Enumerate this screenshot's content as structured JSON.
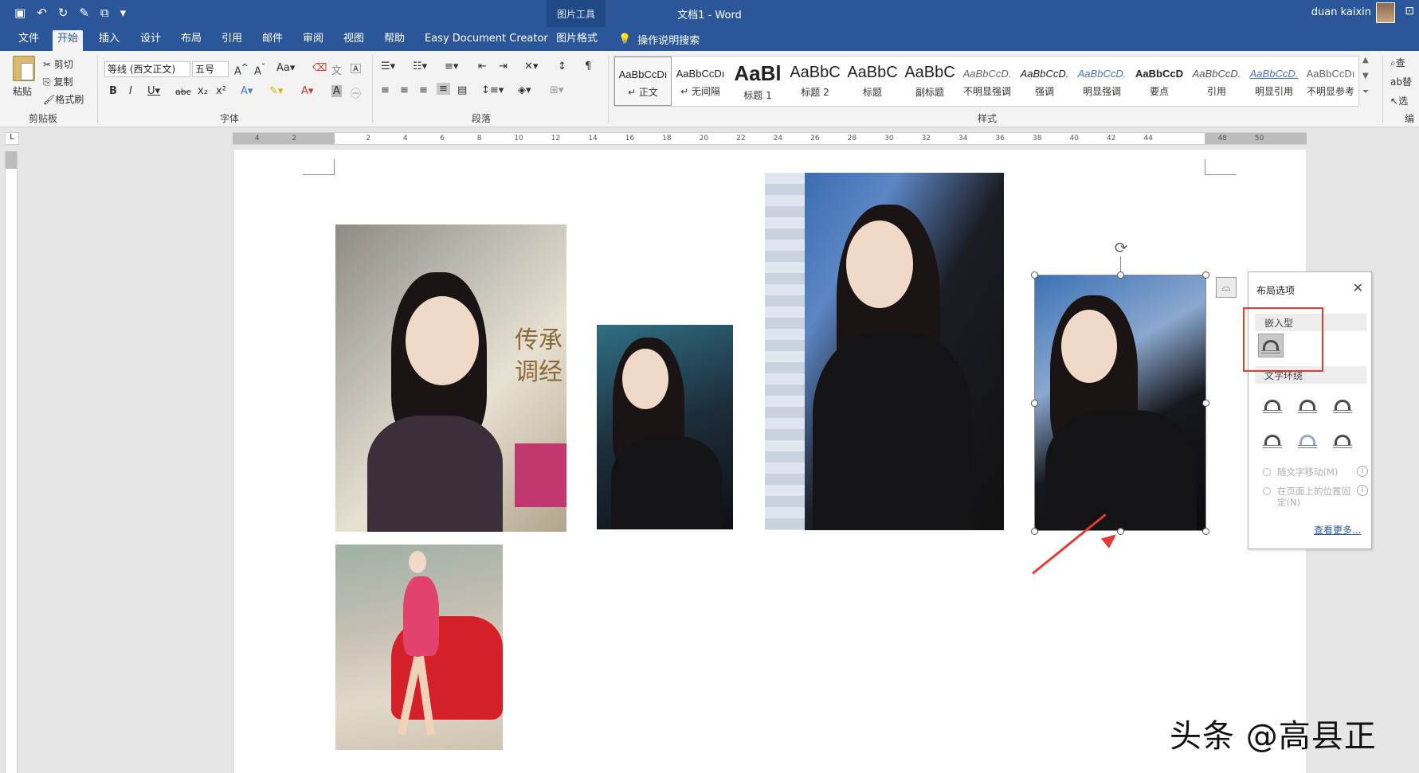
{
  "titlebar": {
    "picture_tools_label": "图片工具",
    "document_title": "文档1  -  Word",
    "user_name": "duan kaixin"
  },
  "tabs": [
    {
      "label": "文件"
    },
    {
      "label": "开始"
    },
    {
      "label": "插入"
    },
    {
      "label": "设计"
    },
    {
      "label": "布局"
    },
    {
      "label": "引用"
    },
    {
      "label": "邮件"
    },
    {
      "label": "审阅"
    },
    {
      "label": "视图"
    },
    {
      "label": "帮助"
    },
    {
      "label": "Easy Document Creator"
    },
    {
      "label": "图片格式"
    }
  ],
  "tell_me": "操作说明搜索",
  "clipboard": {
    "paste": "粘贴",
    "cut": "剪切",
    "copy": "复制",
    "format_painter": "格式刷",
    "group_label": "剪贴板"
  },
  "font": {
    "font_name": "等线 (西文正文)",
    "font_size": "五号",
    "group_label": "字体"
  },
  "paragraph": {
    "group_label": "段落"
  },
  "styles": {
    "group_label": "样式",
    "items": [
      {
        "sample": "AaBbCcDı",
        "name": "↵ 正文"
      },
      {
        "sample": "AaBbCcDı",
        "name": "↵ 无间隔"
      },
      {
        "sample": "AaBl",
        "name": "标题 1"
      },
      {
        "sample": "AaBbC",
        "name": "标题 2"
      },
      {
        "sample": "AaBbC",
        "name": "标题"
      },
      {
        "sample": "AaBbC",
        "name": "副标题"
      },
      {
        "sample": "AaBbCcD.",
        "name": "不明显强调"
      },
      {
        "sample": "AaBbCcD.",
        "name": "强调"
      },
      {
        "sample": "AaBbCcD.",
        "name": "明显强调"
      },
      {
        "sample": "AaBbCcD",
        "name": "要点"
      },
      {
        "sample": "AaBbCcD.",
        "name": "引用"
      },
      {
        "sample": "AaBbCcD.",
        "name": "明显引用"
      },
      {
        "sample": "AaBbCcDı",
        "name": "不明显参考"
      }
    ]
  },
  "editing": {
    "find": "查",
    "replace": "替",
    "select": "选",
    "group_label": "编"
  },
  "ruler": {
    "ticks": [
      "4",
      "2",
      "",
      "2",
      "4",
      "6",
      "8",
      "10",
      "12",
      "14",
      "16",
      "18",
      "20",
      "22",
      "24",
      "26",
      "28",
      "30",
      "32",
      "34",
      "36",
      "38",
      "40",
      "42",
      "44",
      "",
      "48",
      "50"
    ]
  },
  "layout_panel": {
    "title": "布局选项",
    "inline_header": "嵌入型",
    "wrap_header": "文字环绕",
    "move_with_text": "随文字移动(M)",
    "fix_position": "在页面上的位置固定(N)",
    "see_more": "查看更多..."
  },
  "watermark": "头条 @高县正"
}
